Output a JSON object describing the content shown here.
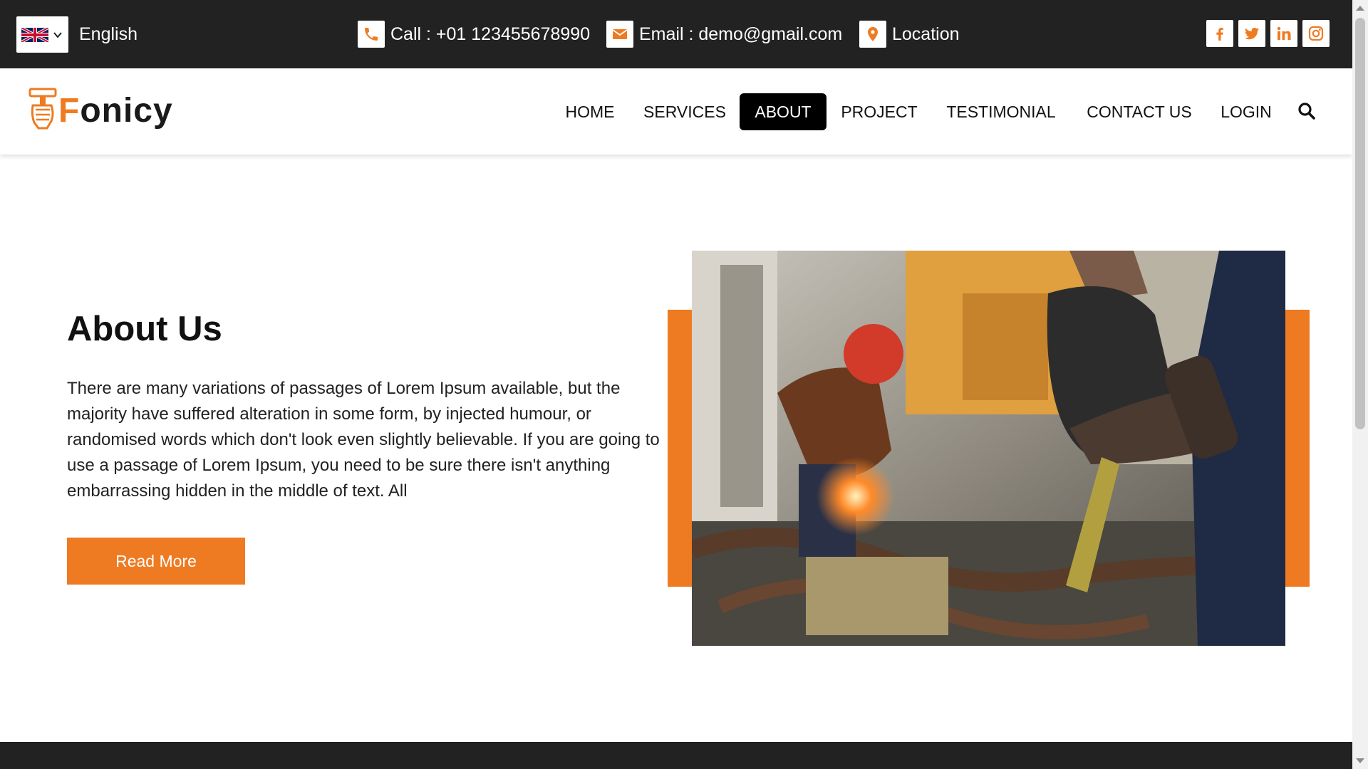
{
  "topbar": {
    "language": "English",
    "call": "Call : +01 123455678990",
    "email": "Email : demo@gmail.com",
    "location": "Location",
    "socials": [
      "facebook-icon",
      "twitter-icon",
      "linkedin-icon",
      "instagram-icon"
    ]
  },
  "brand": {
    "name_first": "F",
    "name_rest": "onicy"
  },
  "nav": {
    "items": [
      {
        "label": "HOME"
      },
      {
        "label": "SERVICES"
      },
      {
        "label": "ABOUT"
      },
      {
        "label": "PROJECT"
      },
      {
        "label": "TESTIMONIAL"
      },
      {
        "label": "CONTACT US"
      },
      {
        "label": "LOGIN"
      }
    ],
    "active": "ABOUT"
  },
  "about": {
    "title": "About Us",
    "body": "There are many variations of passages of Lorem Ipsum available, but the majority have suffered alteration in some form, by injected humour, or randomised words which don't look even slightly believable. If you are going to use a passage of Lorem Ipsum, you need to be sure there isn't anything embarrassing hidden in the middle of text. All",
    "button": "Read More"
  },
  "colors": {
    "accent": "#ee7b22",
    "dark": "#222222",
    "active_nav": "#000000"
  }
}
